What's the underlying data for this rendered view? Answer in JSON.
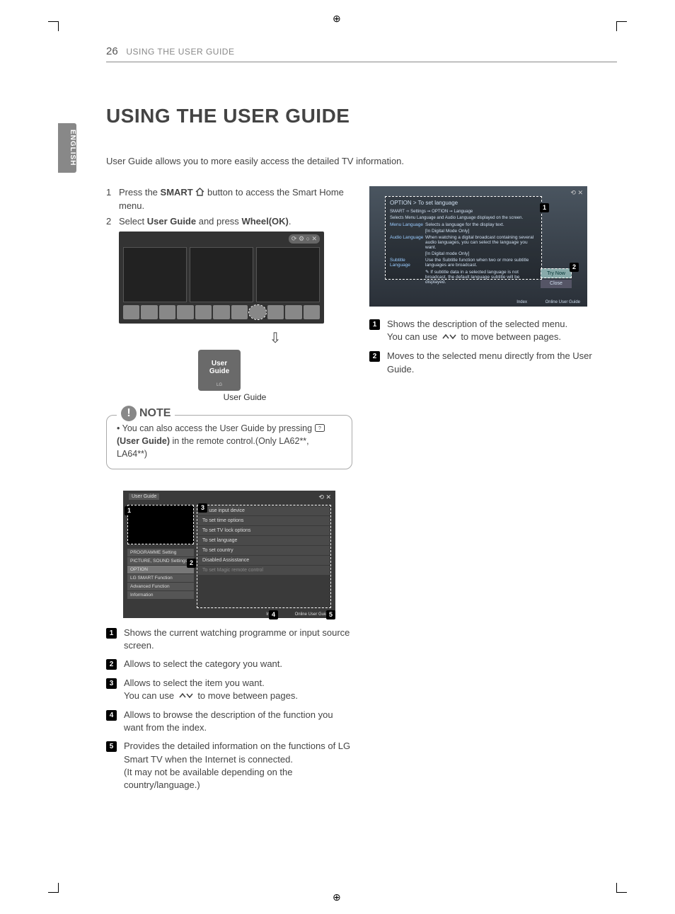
{
  "header": {
    "page_number": "26",
    "section": "USING THE USER GUIDE"
  },
  "language_tab": "ENGLISH",
  "title": "USING THE USER GUIDE",
  "intro": "User Guide allows you to more easily access the detailed TV information.",
  "steps": {
    "s1a": "Press the ",
    "s1b": "SMART",
    "s1c": " button to access the Smart Home menu.",
    "s2a": "Select ",
    "s2b": "User Guide",
    "s2c": " and press ",
    "s2d": "Wheel(OK)",
    "s2e": "."
  },
  "user_guide_card": {
    "line1": "User",
    "line2": "Guide",
    "brand": "LG",
    "caption": "User Guide"
  },
  "note": {
    "label": "NOTE",
    "text_a": "You can also access the User Guide by pressing ",
    "text_b": "(User Guide)",
    "text_c": " in the remote control.(Only LA62**, LA64**)"
  },
  "screenshot2": {
    "window_title": "User Guide",
    "categories": [
      "PROGRAMME Setting",
      "PICTURE, SOUND Settings",
      "OPTION",
      "LG SMART Function",
      "Advanced Function",
      "Information"
    ],
    "items": [
      "To use input device",
      "To set time options",
      "To set TV lock options",
      "To set language",
      "To set country",
      "Disabled Assisstance",
      "To set Magic remote control"
    ],
    "footer_index": "Index",
    "footer_online": "Online User Guide"
  },
  "legendA": {
    "i1": "Shows the current watching programme or input source screen.",
    "i2": "Allows to select the category you want.",
    "i3a": "Allows to select the item you want.",
    "i3b": "You can use ",
    "i3c": " to move between pages.",
    "i4": "Allows to browse the description of the function you want from the index.",
    "i5": "Provides the detailed information on the functions of LG Smart TV when the Internet is connected.\n(It may not be available depending on the country/language.)"
  },
  "screenshot3": {
    "breadcrumb_title": "OPTION > To set language",
    "crumb1": "SMART ➾ Settings ➙ OPTION ➙ Language",
    "crumb2": "Selects Menu Language and Audio Language displayed on the screen.",
    "rows": [
      {
        "lbl": "Menu Language",
        "val": "Selects a language for the display text."
      },
      {
        "lbl": "",
        "val": "[In Digital Mode Only]"
      },
      {
        "lbl": "Audio Language",
        "val": "When watching a digital broadcast containing several audio languages, you can select the language you want."
      },
      {
        "lbl": "",
        "val": "[In Digital mode Only]"
      },
      {
        "lbl": "Subtitle Language",
        "val": "Use the Subtitle function when two or more subtitle languages are broadcast."
      },
      {
        "lbl": "",
        "val": "✎ If subtitle data in a selected language is not broadcast, the default language subtitle will be displayed."
      }
    ],
    "try_now": "Try Now",
    "close": "Close",
    "footer_index": "Index",
    "footer_online": "Online User Guide"
  },
  "legendB": {
    "i1a": "Shows the description of the selected menu.",
    "i1b": "You can use ",
    "i1c": " to move between pages.",
    "i2": "Moves to the selected menu directly from the User Guide."
  }
}
